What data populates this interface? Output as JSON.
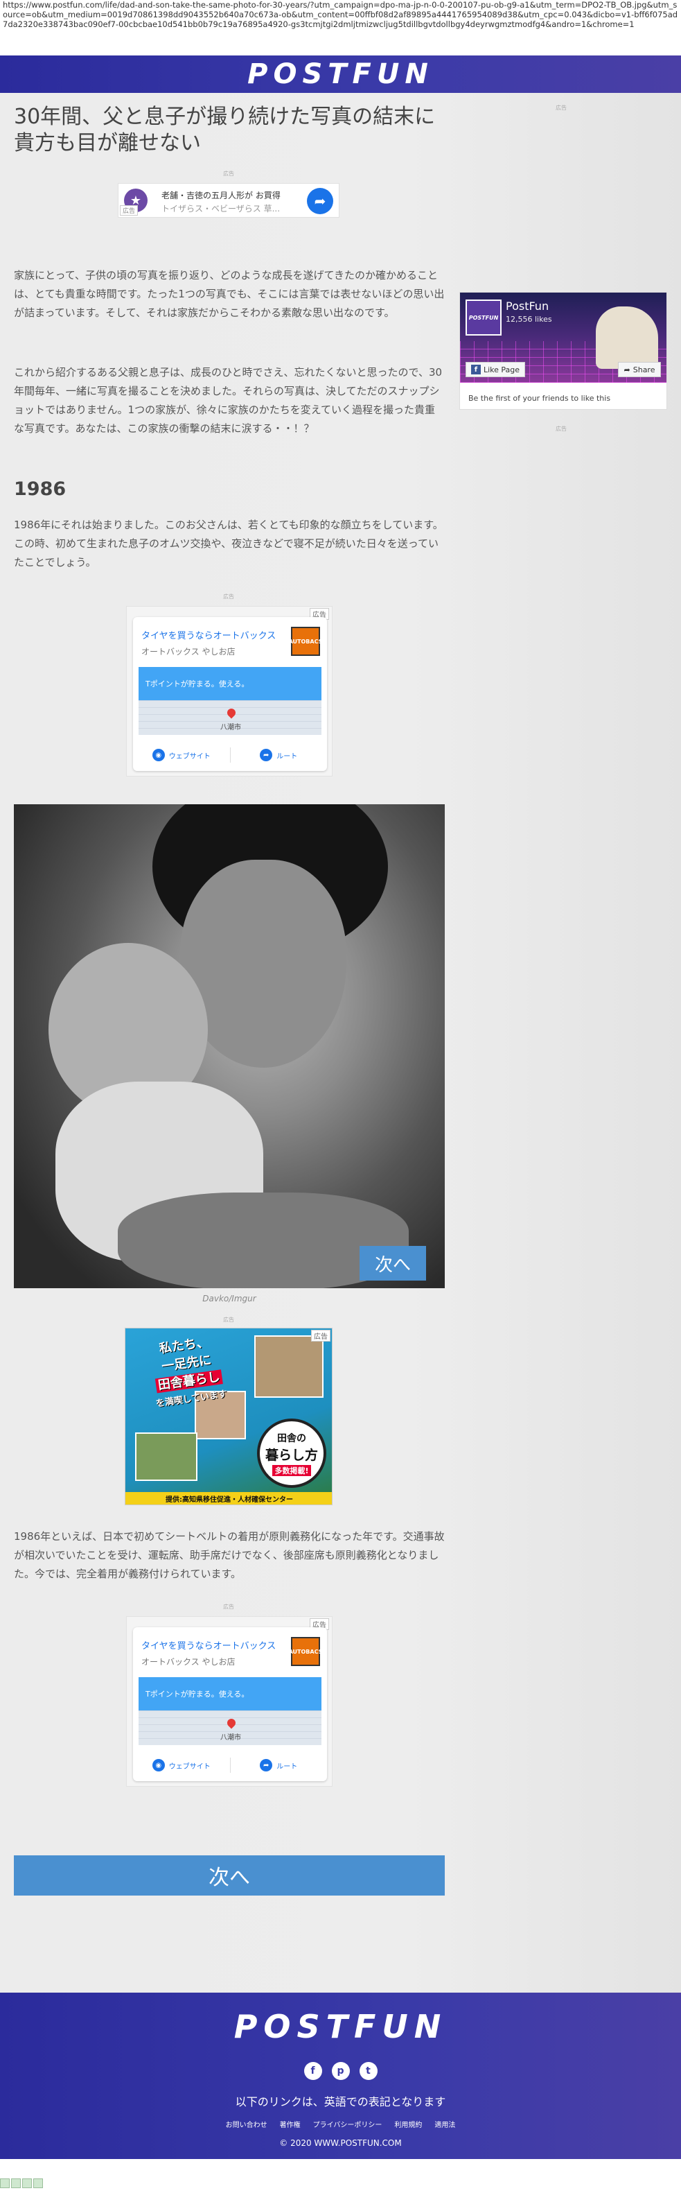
{
  "browser": {
    "url": "https://www.postfun.com/life/dad-and-son-take-the-same-photo-for-30-years/?utm_campaign=dpo-ma-jp-n-0-0-200107-pu-ob-g9-a1&utm_term=DPO2-TB_OB.jpg&utm_source=ob&utm_medium=0019d70861398dd9043552b640a70c673a-ob&utm_content=00ffbf08d2af89895a4441765954089d38&utm_cpc=0.043&dicbo=v1-bff6f075ad7da2320e338743bac090ef7-00cbcbae10d541bb0b79c19a76895a4920-gs3tcmjtgi2dmljtmizwcljug5tdillbgvtdollbgy4deyrwgmztmodfg4&andro=1&chrome=1"
  },
  "site": {
    "logo": "POSTFUN"
  },
  "article": {
    "title": "30年間、父と息子が撮り続けた写真の結末に貴方も目が離せない",
    "p1": "家族にとって、子供の頃の写真を振り返り、どのような成長を遂げてきたのか確かめることは、とても貴重な時間です。たった1つの写真でも、そこには言葉では表せないほどの思い出が詰まっています。そして、それは家族だからこそわかる素敵な思い出なのです。",
    "p2": "これから紹介するある父親と息子は、成長のひと時でさえ、忘れたくないと思ったので、30年間毎年、一緒に写真を撮ることを決めました。それらの写真は、決してただのスナップショットではありません。1つの家族が、徐々に家族のかたちを変えていく過程を撮った貴重な写真です。あなたは、この家族の衝撃の結末に涙する・・！？",
    "year_heading": "1986",
    "p3": "1986年にそれは始まりました。このお父さんは、若くとても印象的な顔立ちをしています。この時、初めて生まれた息子のオムツ交換や、夜泣きなどで寝不足が続いた日々を送っていたことでしょう。",
    "photo_caption": "Davko/Imgur",
    "photo_next": "次へ",
    "p4": "1986年といえば、日本で初めてシートベルトの着用が原則義務化になった年です。交通事故が相次いでいたことを受け、運転席、助手席だけでなく、後部座席も原則義務化となりました。今では、完全着用が義務付けられています。",
    "next_button": "次へ"
  },
  "ads": {
    "label": "広告",
    "small": {
      "line1": "老舗・吉徳の五月人形が お買得",
      "line2": "トイザらス・ベビーザらス 草...",
      "tag": "広告"
    },
    "maps": {
      "tag": "広告",
      "name": "タイヤを買うならオートバックス",
      "sub": "オートバックス やしお店",
      "logo": "AUTOBACS",
      "promo": "Tポイントが貯まる。使える。",
      "city": "八潮市",
      "website": "ウェブサイト",
      "route": "ルート"
    },
    "banner": {
      "tag": "広告",
      "headline_1": "私たち、",
      "headline_2": "一足先に",
      "headline_3": "田舎暮らし",
      "headline_4": "を満喫しています",
      "circle_1": "田舎の",
      "circle_2": "暮らし方",
      "circle_3": "多数掲載!",
      "footer": "提供:高知県移住促進・人材確保センター"
    }
  },
  "facebook": {
    "page_name": "PostFun",
    "likes": "12,556 likes",
    "like_button": "Like Page",
    "share_button": "Share",
    "first_friend": "Be the first of your friends to like this",
    "avatar_text": "POSTFUN"
  },
  "footer": {
    "logo": "POSTFUN",
    "socials": [
      "f",
      "p",
      "t"
    ],
    "note": "以下のリンクは、英語での表記となります",
    "links": [
      "お問い合わせ",
      "著作権",
      "プライバシーポリシー",
      "利用規約",
      "適用法"
    ],
    "copyright": "© 2020 WWW.POSTFUN.COM"
  },
  "colors": {
    "brand": "#3a3aa8",
    "button": "#4a90d0"
  }
}
